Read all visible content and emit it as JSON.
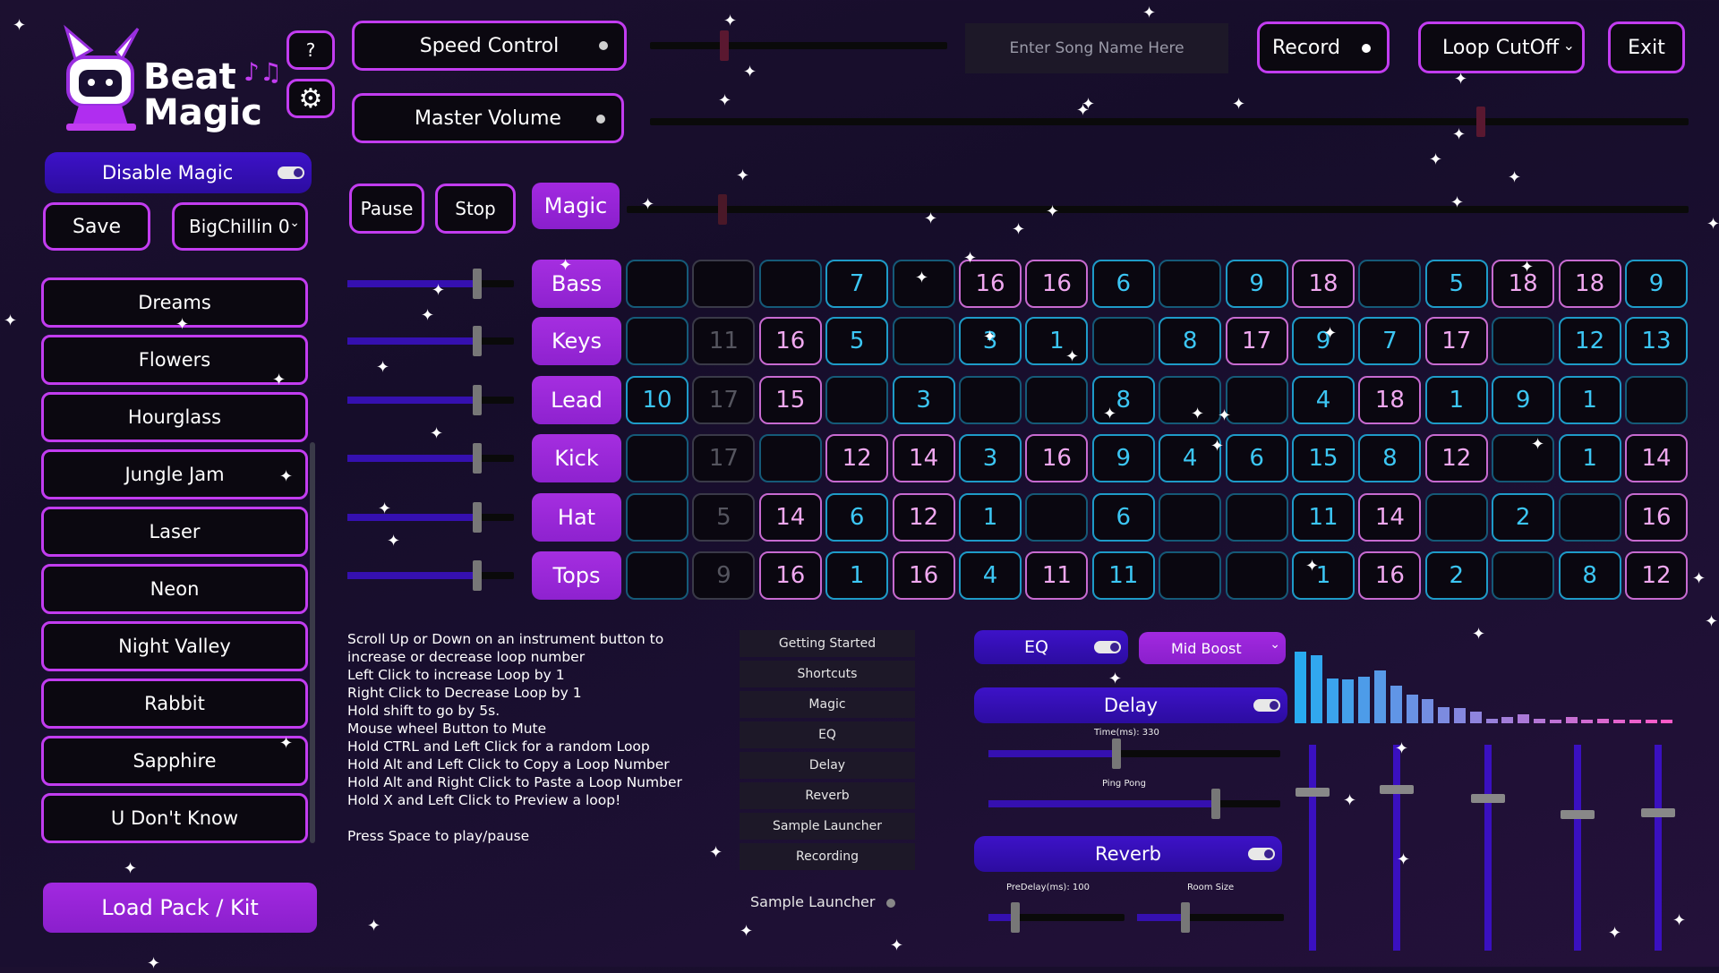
{
  "app": {
    "name_line1": "Beat",
    "name_line2": "Magic"
  },
  "top": {
    "help_label": "?",
    "speed_control": "Speed Control",
    "master_volume": "Master Volume",
    "song_name_placeholder": "Enter Song Name Here",
    "record": "Record",
    "loop_cutoff": "Loop CutOff",
    "exit": "Exit",
    "speed_value": 0.25,
    "volume_value": 0.8,
    "magic_value": 0.09
  },
  "left": {
    "disable_magic": "Disable Magic",
    "save": "Save",
    "preset_selected": "BigChillin 0",
    "packs": [
      "Dreams",
      "Flowers",
      "Hourglass",
      "Jungle Jam",
      "Laser",
      "Neon",
      "Night Valley",
      "Rabbit",
      "Sapphire",
      "U Don't Know"
    ],
    "load_pack": "Load Pack / Kit"
  },
  "transport": {
    "pause": "Pause",
    "stop": "Stop",
    "magic": "Magic"
  },
  "instruments": [
    {
      "name": "Bass",
      "volume": 0.78
    },
    {
      "name": "Keys",
      "volume": 0.78
    },
    {
      "name": "Lead",
      "volume": 0.78
    },
    {
      "name": "Kick",
      "volume": 0.78
    },
    {
      "name": "Hat",
      "volume": 0.78
    },
    {
      "name": "Tops",
      "volume": 0.78
    }
  ],
  "grid": [
    [
      [
        "b",
        ""
      ],
      [
        "g",
        ""
      ],
      [
        "b",
        ""
      ],
      [
        "c",
        "7"
      ],
      [
        "b",
        ""
      ],
      [
        "p",
        "16"
      ],
      [
        "p",
        "16"
      ],
      [
        "c",
        "6"
      ],
      [
        "b",
        ""
      ],
      [
        "c",
        "9"
      ],
      [
        "p",
        "18"
      ],
      [
        "b",
        ""
      ],
      [
        "c",
        "5"
      ],
      [
        "p",
        "18"
      ],
      [
        "p",
        "18"
      ],
      [
        "c",
        "9"
      ]
    ],
    [
      [
        "b",
        ""
      ],
      [
        "d",
        "11"
      ],
      [
        "p",
        "16"
      ],
      [
        "c",
        "5"
      ],
      [
        "b",
        ""
      ],
      [
        "c",
        "3"
      ],
      [
        "c",
        "1"
      ],
      [
        "b",
        ""
      ],
      [
        "c",
        "8"
      ],
      [
        "p",
        "17"
      ],
      [
        "c",
        "9"
      ],
      [
        "c",
        "7"
      ],
      [
        "p",
        "17"
      ],
      [
        "b",
        ""
      ],
      [
        "c",
        "12"
      ],
      [
        "c",
        "13"
      ]
    ],
    [
      [
        "c",
        "10"
      ],
      [
        "d",
        "17"
      ],
      [
        "p",
        "15"
      ],
      [
        "b",
        ""
      ],
      [
        "c",
        "3"
      ],
      [
        "b",
        ""
      ],
      [
        "b",
        ""
      ],
      [
        "c",
        "8"
      ],
      [
        "b",
        ""
      ],
      [
        "b",
        ""
      ],
      [
        "c",
        "4"
      ],
      [
        "p",
        "18"
      ],
      [
        "c",
        "1"
      ],
      [
        "c",
        "9"
      ],
      [
        "c",
        "1"
      ],
      [
        "b",
        ""
      ]
    ],
    [
      [
        "b",
        ""
      ],
      [
        "d",
        "17"
      ],
      [
        "b",
        ""
      ],
      [
        "p",
        "12"
      ],
      [
        "p",
        "14"
      ],
      [
        "c",
        "3"
      ],
      [
        "p",
        "16"
      ],
      [
        "c",
        "9"
      ],
      [
        "c",
        "4"
      ],
      [
        "c",
        "6"
      ],
      [
        "c",
        "15"
      ],
      [
        "c",
        "8"
      ],
      [
        "p",
        "12"
      ],
      [
        "b",
        ""
      ],
      [
        "c",
        "1"
      ],
      [
        "p",
        "14"
      ]
    ],
    [
      [
        "b",
        ""
      ],
      [
        "d",
        "5"
      ],
      [
        "p",
        "14"
      ],
      [
        "c",
        "6"
      ],
      [
        "p",
        "12"
      ],
      [
        "c",
        "1"
      ],
      [
        "b",
        ""
      ],
      [
        "c",
        "6"
      ],
      [
        "b",
        ""
      ],
      [
        "b",
        ""
      ],
      [
        "c",
        "11"
      ],
      [
        "p",
        "14"
      ],
      [
        "b",
        ""
      ],
      [
        "c",
        "2"
      ],
      [
        "b",
        ""
      ],
      [
        "p",
        "16"
      ]
    ],
    [
      [
        "b",
        ""
      ],
      [
        "d",
        "9"
      ],
      [
        "p",
        "16"
      ],
      [
        "c",
        "1"
      ],
      [
        "p",
        "16"
      ],
      [
        "c",
        "4"
      ],
      [
        "p",
        "11"
      ],
      [
        "c",
        "11"
      ],
      [
        "b",
        ""
      ],
      [
        "b",
        ""
      ],
      [
        "c",
        "1"
      ],
      [
        "p",
        "16"
      ],
      [
        "c",
        "2"
      ],
      [
        "b",
        ""
      ],
      [
        "c",
        "8"
      ],
      [
        "p",
        "12"
      ]
    ]
  ],
  "instructions": [
    "Scroll Up or Down on an instrument button to",
    "increase or decrease loop number",
    "Left Click to increase Loop by 1",
    "Right Click to Decrease Loop by 1",
    "Hold shift to go by 5s.",
    "Mouse wheel Button to Mute",
    "Hold CTRL and Left Click for a random Loop",
    "Hold Alt and Left Click to Copy a Loop Number",
    "Hold Alt and Right Click to Paste a Loop Number",
    "Hold X and Left Click to Preview a loop!",
    "",
    "Press Space to play/pause"
  ],
  "help_menu": [
    "Getting Started",
    "Shortcuts",
    "Magic",
    "EQ",
    "Delay",
    "Reverb",
    "Sample Launcher",
    "Recording"
  ],
  "sample_launcher_label": "Sample Launcher",
  "effects": {
    "eq": "EQ",
    "eq_preset": "Mid Boost",
    "delay": "Delay",
    "delay_time_label": "Time(ms): 330",
    "ping_pong_label": "Ping Pong",
    "delay_time_value": 0.44,
    "ping_pong_value": 0.78,
    "reverb": "Reverb",
    "predelay_label": "PreDelay(ms): 100",
    "room_size_label": "Room Size",
    "predelay_value": 0.2,
    "room_size_value": 0.33
  },
  "spectrum": [
    0.95,
    0.9,
    0.6,
    0.58,
    0.62,
    0.7,
    0.5,
    0.38,
    0.32,
    0.22,
    0.2,
    0.15,
    0.06,
    0.08,
    0.12,
    0.06,
    0.05,
    0.08,
    0.05,
    0.06,
    0.05,
    0.05,
    0.05,
    0.05
  ],
  "eq_faders": [
    0.88,
    0.89,
    0.85,
    0.77,
    0.78
  ],
  "colors": {
    "accent": "#c23cf0",
    "button_purple": "#9a26d8",
    "indigo": "#3510b0",
    "cyan": "#3cc6f4",
    "pink": "#f0a8f0"
  }
}
